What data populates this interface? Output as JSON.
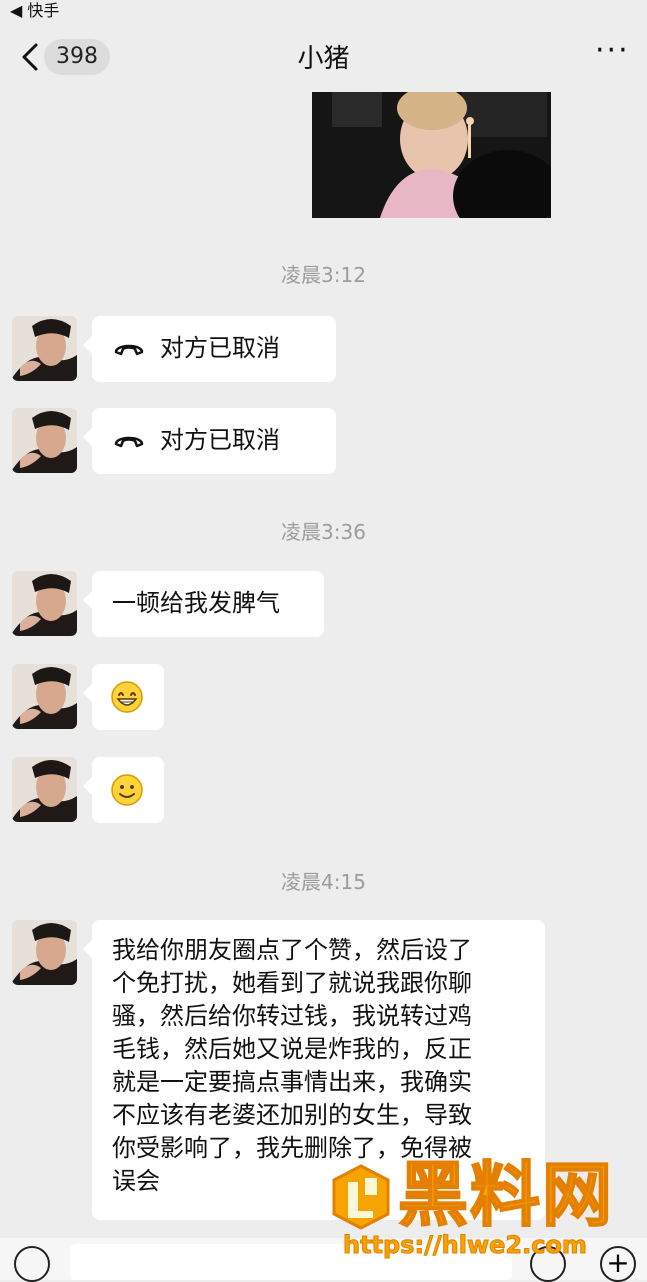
{
  "status_bar": {
    "back_app_label": "◀ 快手"
  },
  "nav": {
    "unread_count": "398",
    "chat_title": "小猪",
    "more_label": "···"
  },
  "messages": {
    "time_1": "凌晨3:12",
    "call_1": "对方已取消",
    "call_2": "对方已取消",
    "time_2": "凌晨3:36",
    "text_1": "一顿给我发脾气",
    "time_3": "凌晨4:15",
    "text_2_lines": [
      "我给你朋友圈点了个赞，然后设了",
      "个免打扰，她看到了就说我跟你聊",
      "骚，然后给你转过钱，我说转过鸡",
      "毛钱，然后她又说是炸我的，反正",
      "就是一定要搞点事情出来，我确实",
      "不应该有老婆还加别的女生，导致",
      "你受影响了，我先删除了，免得被",
      "误会"
    ]
  },
  "watermark": {
    "title": "黑料网",
    "url": "https://hlwe2.com"
  },
  "colors": {
    "background": "#ededed",
    "bubble": "#ffffff",
    "timestamp": "#9c9c9c",
    "watermark": "#f5a400"
  }
}
